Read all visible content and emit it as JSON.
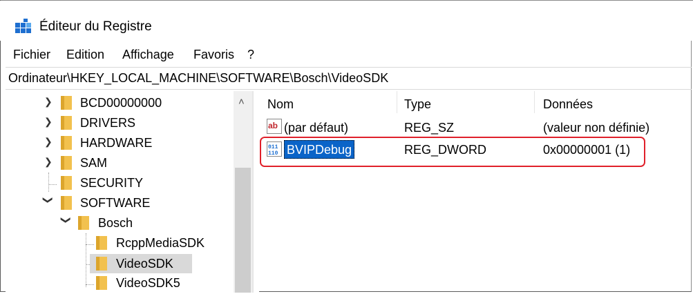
{
  "window": {
    "title": "Éditeur du Registre"
  },
  "menu": [
    "Fichier",
    "Edition",
    "Affichage",
    "Favoris",
    "?"
  ],
  "address": "Ordinateur\\HKEY_LOCAL_MACHINE\\SOFTWARE\\Bosch\\VideoSDK",
  "tree": {
    "items": [
      {
        "label": "BCD00000000",
        "expanded": false
      },
      {
        "label": "DRIVERS",
        "expanded": false
      },
      {
        "label": "HARDWARE",
        "expanded": false
      },
      {
        "label": "SAM",
        "expanded": false
      },
      {
        "label": "SECURITY",
        "expanded": null
      },
      {
        "label": "SOFTWARE",
        "expanded": true
      },
      {
        "label": "Bosch",
        "expanded": true
      },
      {
        "label": "RcppMediaSDK",
        "expanded": null
      },
      {
        "label": "VideoSDK",
        "expanded": null,
        "selected": true
      },
      {
        "label": "VideoSDK5",
        "expanded": null
      }
    ]
  },
  "list": {
    "columns": [
      "Nom",
      "Type",
      "Données"
    ],
    "rows": [
      {
        "name": "(par défaut)",
        "type": "REG_SZ",
        "data": "(valeur non définie)",
        "icon": "string-value-icon"
      },
      {
        "name": "BVIPDebug",
        "type": "REG_DWORD",
        "data": "0x00000001 (1)",
        "icon": "dword-value-icon",
        "selected": true
      }
    ]
  },
  "colors": {
    "selection": "#0a64c8",
    "highlight": "#e0202a",
    "folder": "#f2c14e"
  }
}
